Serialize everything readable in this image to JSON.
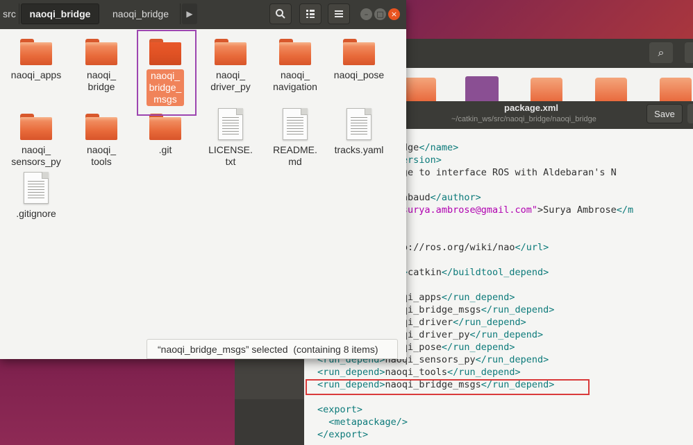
{
  "file_manager": {
    "breadcrumbs": [
      "src",
      "naoqi_bridge",
      "naoqi_bridge"
    ],
    "toolbar": {
      "search_icon": "search-icon",
      "view_icon": "grid-view-icon",
      "menu_icon": "hamburger-menu-icon"
    },
    "window_controls": {
      "minimize": "–",
      "maximize": "□",
      "close": "×"
    },
    "items": [
      {
        "label": "naoqi_apps",
        "type": "folder"
      },
      {
        "label": "naoqi_\nbridge",
        "type": "folder"
      },
      {
        "label": "naoqi_\nbridge_\nmsgs",
        "type": "folder",
        "selected": true
      },
      {
        "label": "naoqi_\ndriver_py",
        "type": "folder"
      },
      {
        "label": "naoqi_\nnavigation",
        "type": "folder"
      },
      {
        "label": "naoqi_pose",
        "type": "folder"
      },
      {
        "label": "naoqi_\nsensors_py",
        "type": "folder"
      },
      {
        "label": "naoqi_\ntools",
        "type": "folder"
      },
      {
        "label": ".git",
        "type": "folder"
      },
      {
        "label": "LICENSE.\ntxt",
        "type": "file"
      },
      {
        "label": "README.\nmd",
        "type": "file"
      },
      {
        "label": "tracks.yaml",
        "type": "file"
      },
      {
        "label": ".gitignore",
        "type": "file"
      }
    ],
    "status_text": "“naoqi_bridge_msgs” selected  (containing 8 items)"
  },
  "editor": {
    "title": "package.xml",
    "path": "~/catkin_ws/src/naoqi_bridge/naoqi_bridge",
    "save_label": "Save"
  },
  "colors": {
    "accent": "#e95420",
    "selection": "#f0835a",
    "highlight_box": "#9c45b0",
    "red_box": "#d93a3a"
  }
}
